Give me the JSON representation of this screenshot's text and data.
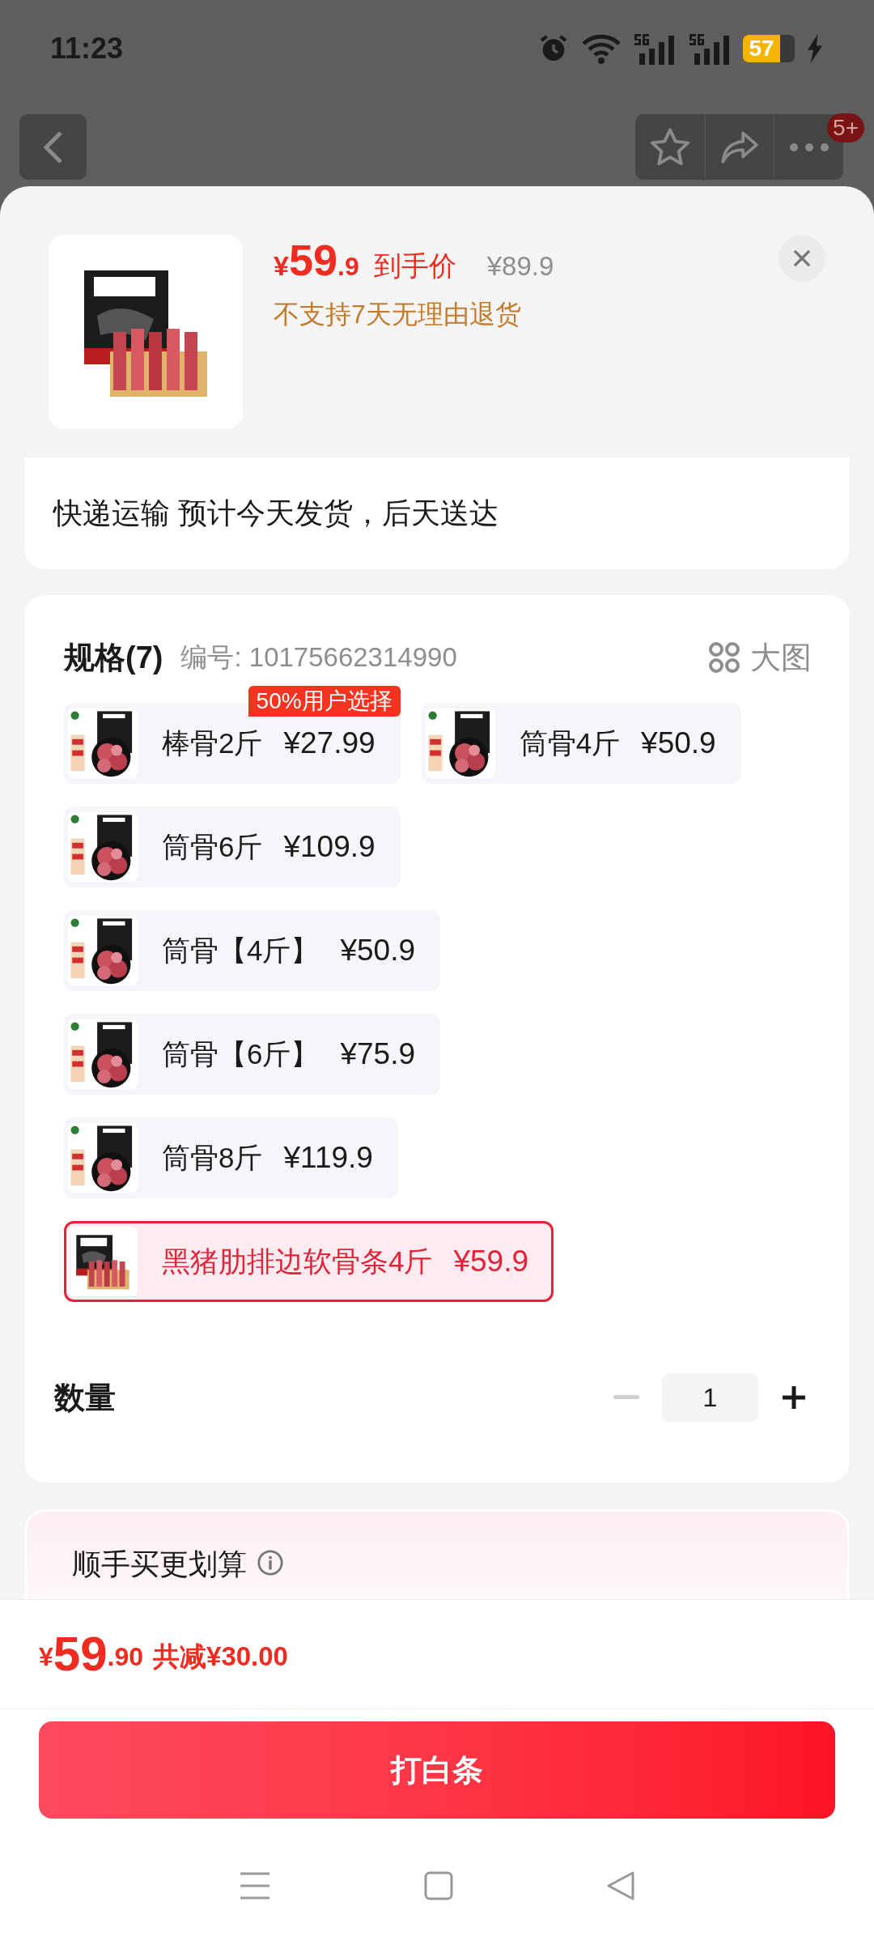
{
  "status_bar": {
    "time": "11:23",
    "battery": "57"
  },
  "header": {
    "badge": "5+"
  },
  "product": {
    "currency": "¥",
    "price_int": "59",
    "price_dec": ".9",
    "price_label": "到手价",
    "original_price": "¥89.9",
    "notice": "不支持7天无理由退货"
  },
  "delivery": {
    "text": "快递运输 预计今天发货，后天送达"
  },
  "specs": {
    "title": "规格(7)",
    "code": "编号: 10175662314990",
    "view_label": "大图",
    "options": [
      {
        "name": "棒骨2斤",
        "price": "¥27.99",
        "selected": false,
        "badge": "50%用户选择",
        "kind": "bone"
      },
      {
        "name": "筒骨4斤",
        "price": "¥50.9",
        "selected": false,
        "kind": "bone"
      },
      {
        "name": "筒骨6斤",
        "price": "¥109.9",
        "selected": false,
        "kind": "bone"
      },
      {
        "name": "筒骨【4斤】",
        "price": "¥50.9",
        "selected": false,
        "kind": "bone"
      },
      {
        "name": "筒骨【6斤】",
        "price": "¥75.9",
        "selected": false,
        "kind": "bone"
      },
      {
        "name": "筒骨8斤",
        "price": "¥119.9",
        "selected": false,
        "kind": "bone"
      },
      {
        "name": "黑猪肋排边软骨条4斤",
        "price": "¥59.9",
        "selected": true,
        "kind": "ribs"
      }
    ]
  },
  "quantity": {
    "label": "数量",
    "value": "1",
    "decrease_disabled": true
  },
  "upsell": {
    "title": "顺手买更划算"
  },
  "footer": {
    "currency": "¥",
    "total_int": "59",
    "total_dec": ".90",
    "discount": "共减¥30.00",
    "button": "打白条"
  }
}
